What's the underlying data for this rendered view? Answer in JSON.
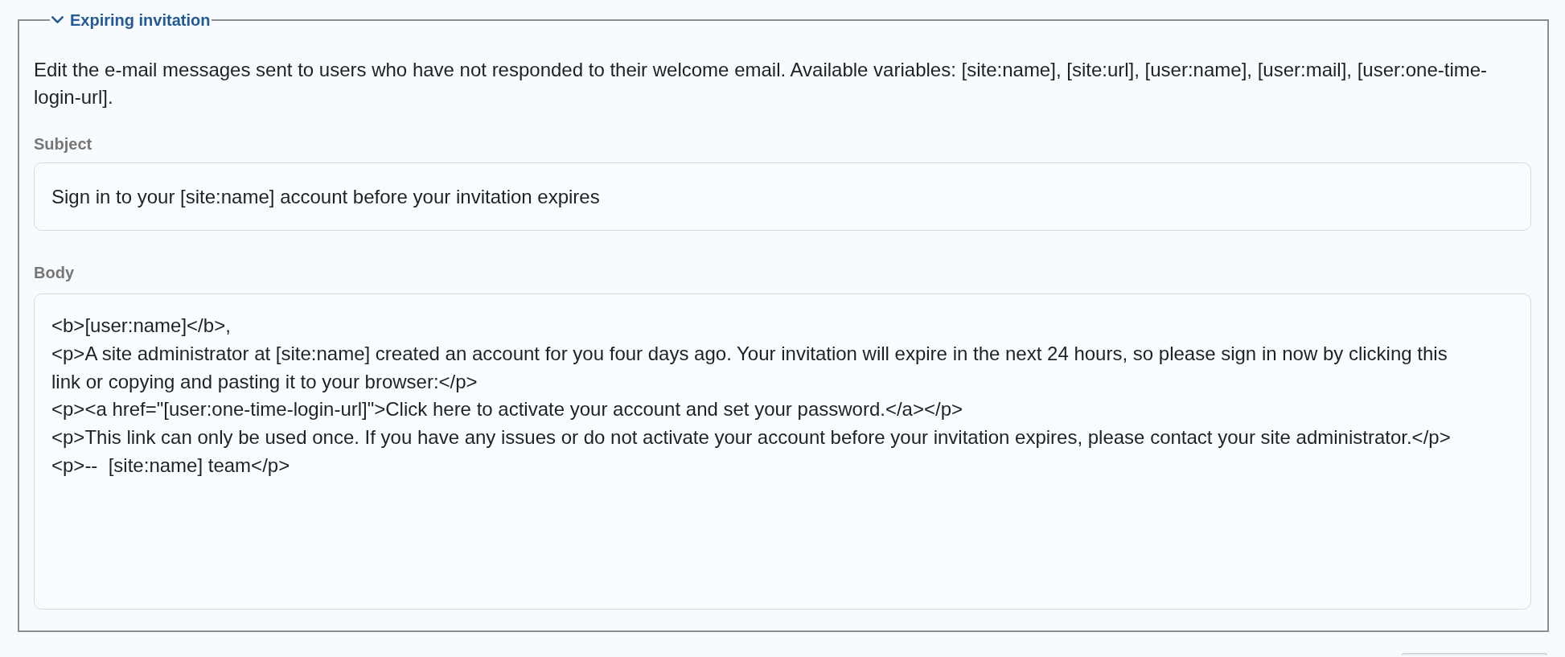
{
  "fieldset": {
    "legend": "Expiring invitation",
    "expanded": true,
    "description": "Edit the e-mail messages sent to users who have not responded to their welcome email. Available variables: [site:name], [site:url], [user:name], [user:mail], [user:one-time-login-url].",
    "fields": [
      {
        "kind": "input",
        "label": "Subject",
        "value": "Sign in to your [site:name] account before your invitation expires"
      },
      {
        "kind": "textarea",
        "label": "Body",
        "value": "<b>[user:name]</b>,\n<p>A site administrator at [site:name] created an account for you four days ago. Your invitation will expire in the next 24 hours, so please sign in now by clicking this link or copying and pasting it to your browser:</p>\n<p><a href=\"[user:one-time-login-url]\">Click here to activate your account and set your password.</a></p>\n<p>This link can only be used once. If you have any issues or do not activate your account before your invitation expires, please contact your site administrator.</p>\n<p>--  [site:name] team</p>"
      }
    ]
  }
}
